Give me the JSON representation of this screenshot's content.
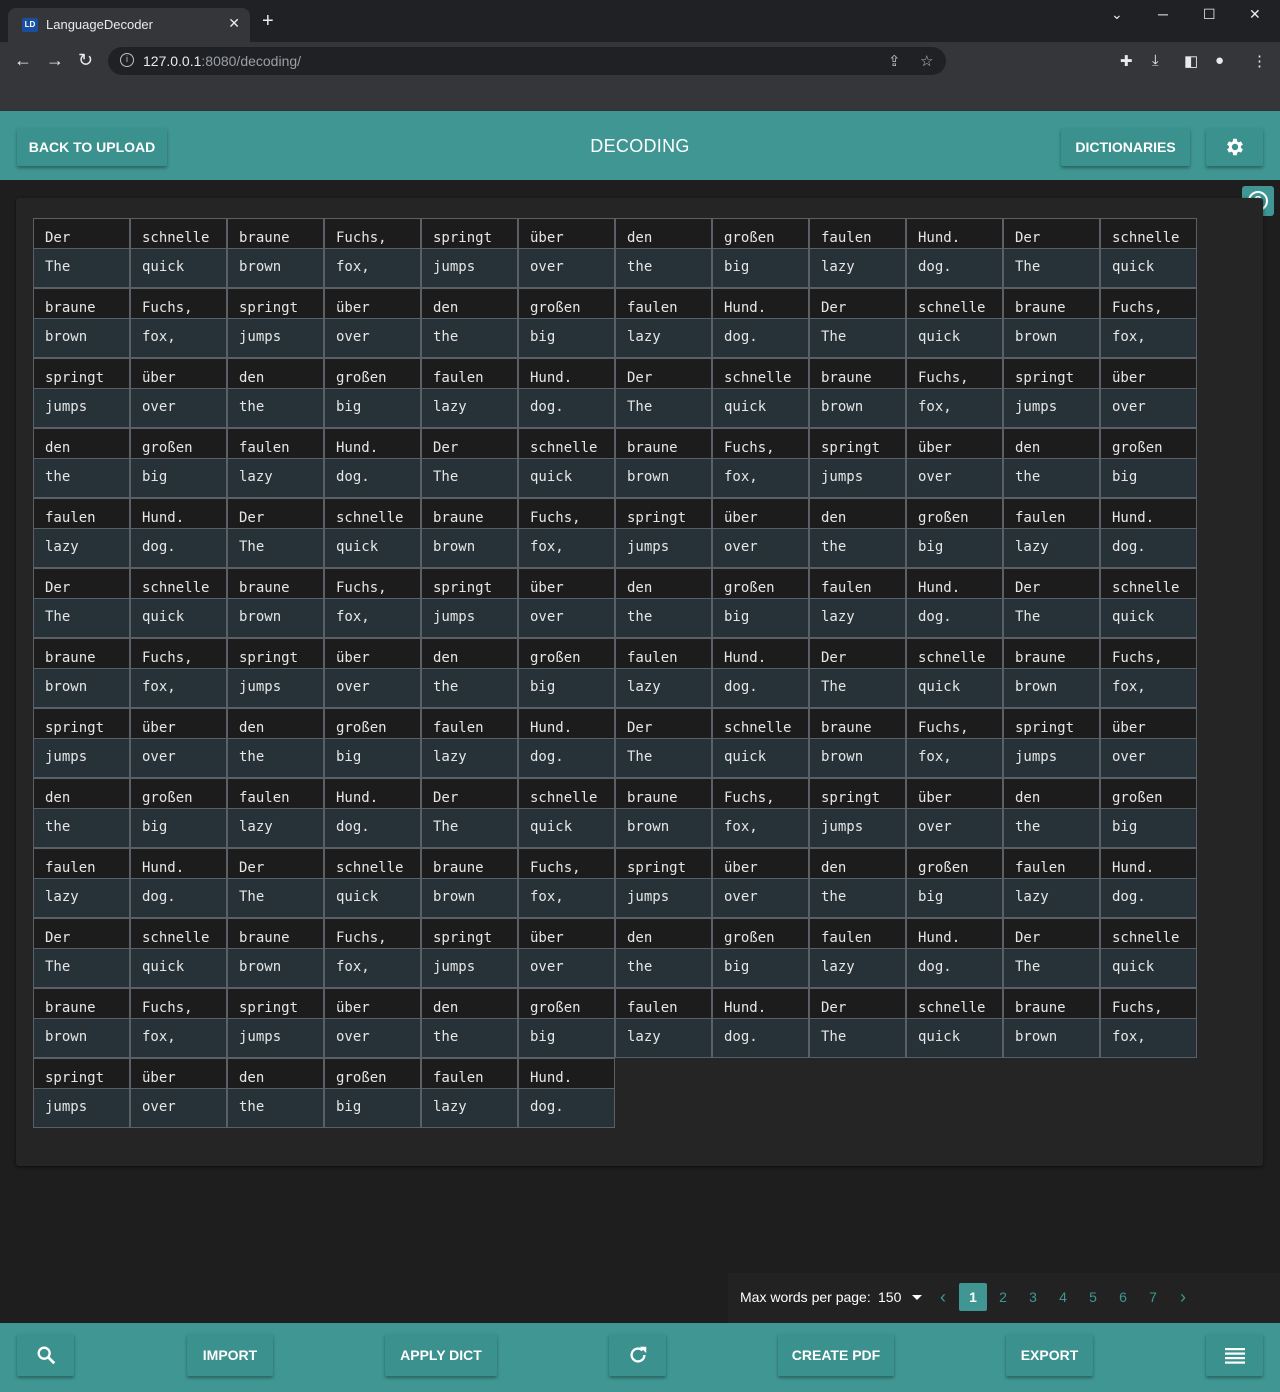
{
  "browser": {
    "tab_title": "LanguageDecoder",
    "tab_icon": "LD",
    "url_host": "127.0.0.1",
    "url_path": ":8080/decoding/"
  },
  "header": {
    "back_label": "BACK TO UPLOAD",
    "title": "DECODING",
    "dictionaries_label": "DICTIONARIES"
  },
  "words": [
    [
      "Der",
      "The"
    ],
    [
      "schnelle",
      "quick"
    ],
    [
      "braune",
      "brown"
    ],
    [
      "Fuchs,",
      "fox,"
    ],
    [
      "springt",
      "jumps"
    ],
    [
      "über",
      "over"
    ],
    [
      "den",
      "the"
    ],
    [
      "großen",
      "big"
    ],
    [
      "faulen",
      "lazy"
    ],
    [
      "Hund.",
      "dog."
    ],
    [
      "Der",
      "The"
    ],
    [
      "schnelle",
      "quick"
    ],
    [
      "braune",
      "brown"
    ],
    [
      "Fuchs,",
      "fox,"
    ],
    [
      "springt",
      "jumps"
    ],
    [
      "über",
      "over"
    ],
    [
      "den",
      "the"
    ],
    [
      "großen",
      "big"
    ],
    [
      "faulen",
      "lazy"
    ],
    [
      "Hund.",
      "dog."
    ],
    [
      "Der",
      "The"
    ],
    [
      "schnelle",
      "quick"
    ],
    [
      "braune",
      "brown"
    ],
    [
      "Fuchs,",
      "fox,"
    ],
    [
      "springt",
      "jumps"
    ],
    [
      "über",
      "over"
    ],
    [
      "den",
      "the"
    ],
    [
      "großen",
      "big"
    ],
    [
      "faulen",
      "lazy"
    ],
    [
      "Hund.",
      "dog."
    ],
    [
      "Der",
      "The"
    ],
    [
      "schnelle",
      "quick"
    ],
    [
      "braune",
      "brown"
    ],
    [
      "Fuchs,",
      "fox,"
    ],
    [
      "springt",
      "jumps"
    ],
    [
      "über",
      "over"
    ],
    [
      "den",
      "the"
    ],
    [
      "großen",
      "big"
    ],
    [
      "faulen",
      "lazy"
    ],
    [
      "Hund.",
      "dog."
    ],
    [
      "Der",
      "The"
    ],
    [
      "schnelle",
      "quick"
    ],
    [
      "braune",
      "brown"
    ],
    [
      "Fuchs,",
      "fox,"
    ],
    [
      "springt",
      "jumps"
    ],
    [
      "über",
      "over"
    ],
    [
      "den",
      "the"
    ],
    [
      "großen",
      "big"
    ],
    [
      "faulen",
      "lazy"
    ],
    [
      "Hund.",
      "dog."
    ],
    [
      "Der",
      "The"
    ],
    [
      "schnelle",
      "quick"
    ],
    [
      "braune",
      "brown"
    ],
    [
      "Fuchs,",
      "fox,"
    ],
    [
      "springt",
      "jumps"
    ],
    [
      "über",
      "over"
    ],
    [
      "den",
      "the"
    ],
    [
      "großen",
      "big"
    ],
    [
      "faulen",
      "lazy"
    ],
    [
      "Hund.",
      "dog."
    ],
    [
      "Der",
      "The"
    ],
    [
      "schnelle",
      "quick"
    ],
    [
      "braune",
      "brown"
    ],
    [
      "Fuchs,",
      "fox,"
    ],
    [
      "springt",
      "jumps"
    ],
    [
      "über",
      "over"
    ],
    [
      "den",
      "the"
    ],
    [
      "großen",
      "big"
    ],
    [
      "faulen",
      "lazy"
    ],
    [
      "Hund.",
      "dog."
    ],
    [
      "Der",
      "The"
    ],
    [
      "schnelle",
      "quick"
    ],
    [
      "braune",
      "brown"
    ],
    [
      "Fuchs,",
      "fox,"
    ],
    [
      "springt",
      "jumps"
    ],
    [
      "über",
      "over"
    ],
    [
      "den",
      "the"
    ],
    [
      "großen",
      "big"
    ],
    [
      "faulen",
      "lazy"
    ],
    [
      "Hund.",
      "dog."
    ],
    [
      "Der",
      "The"
    ],
    [
      "schnelle",
      "quick"
    ],
    [
      "braune",
      "brown"
    ],
    [
      "Fuchs,",
      "fox,"
    ],
    [
      "springt",
      "jumps"
    ],
    [
      "über",
      "over"
    ],
    [
      "den",
      "the"
    ],
    [
      "großen",
      "big"
    ],
    [
      "faulen",
      "lazy"
    ],
    [
      "Hund.",
      "dog."
    ],
    [
      "Der",
      "The"
    ],
    [
      "schnelle",
      "quick"
    ],
    [
      "braune",
      "brown"
    ],
    [
      "Fuchs,",
      "fox,"
    ],
    [
      "springt",
      "jumps"
    ],
    [
      "über",
      "over"
    ],
    [
      "den",
      "the"
    ],
    [
      "großen",
      "big"
    ],
    [
      "faulen",
      "lazy"
    ],
    [
      "Hund.",
      "dog."
    ],
    [
      "Der",
      "The"
    ],
    [
      "schnelle",
      "quick"
    ],
    [
      "braune",
      "brown"
    ],
    [
      "Fuchs,",
      "fox,"
    ],
    [
      "springt",
      "jumps"
    ],
    [
      "über",
      "over"
    ],
    [
      "den",
      "the"
    ],
    [
      "großen",
      "big"
    ],
    [
      "faulen",
      "lazy"
    ],
    [
      "Hund.",
      "dog."
    ],
    [
      "Der",
      "The"
    ],
    [
      "schnelle",
      "quick"
    ],
    [
      "braune",
      "brown"
    ],
    [
      "Fuchs,",
      "fox,"
    ],
    [
      "springt",
      "jumps"
    ],
    [
      "über",
      "over"
    ],
    [
      "den",
      "the"
    ],
    [
      "großen",
      "big"
    ],
    [
      "faulen",
      "lazy"
    ],
    [
      "Hund.",
      "dog."
    ],
    [
      "Der",
      "The"
    ],
    [
      "schnelle",
      "quick"
    ],
    [
      "braune",
      "brown"
    ],
    [
      "Fuchs,",
      "fox,"
    ],
    [
      "springt",
      "jumps"
    ],
    [
      "über",
      "over"
    ],
    [
      "den",
      "the"
    ],
    [
      "großen",
      "big"
    ],
    [
      "faulen",
      "lazy"
    ],
    [
      "Hund.",
      "dog."
    ],
    [
      "Der",
      "The"
    ],
    [
      "schnelle",
      "quick"
    ],
    [
      "braune",
      "brown"
    ],
    [
      "Fuchs,",
      "fox,"
    ],
    [
      "springt",
      "jumps"
    ],
    [
      "über",
      "over"
    ],
    [
      "den",
      "the"
    ],
    [
      "großen",
      "big"
    ],
    [
      "faulen",
      "lazy"
    ],
    [
      "Hund.",
      "dog."
    ],
    [
      "Der",
      "The"
    ],
    [
      "schnelle",
      "quick"
    ],
    [
      "braune",
      "brown"
    ],
    [
      "Fuchs,",
      "fox,"
    ],
    [
      "springt",
      "jumps"
    ],
    [
      "über",
      "over"
    ],
    [
      "den",
      "the"
    ],
    [
      "großen",
      "big"
    ],
    [
      "faulen",
      "lazy"
    ],
    [
      "Hund.",
      "dog."
    ]
  ],
  "pagination": {
    "label": "Max words per page:",
    "per_page": "150",
    "pages": [
      "1",
      "2",
      "3",
      "4",
      "5",
      "6",
      "7"
    ],
    "current": "1"
  },
  "footer": {
    "import_label": "IMPORT",
    "apply_dict_label": "APPLY DICT",
    "create_pdf_label": "CREATE PDF",
    "export_label": "EXPORT"
  },
  "colors": {
    "accent": "#3f9693",
    "target_bg": "#263238",
    "source_bg": "#1c1c1c"
  }
}
